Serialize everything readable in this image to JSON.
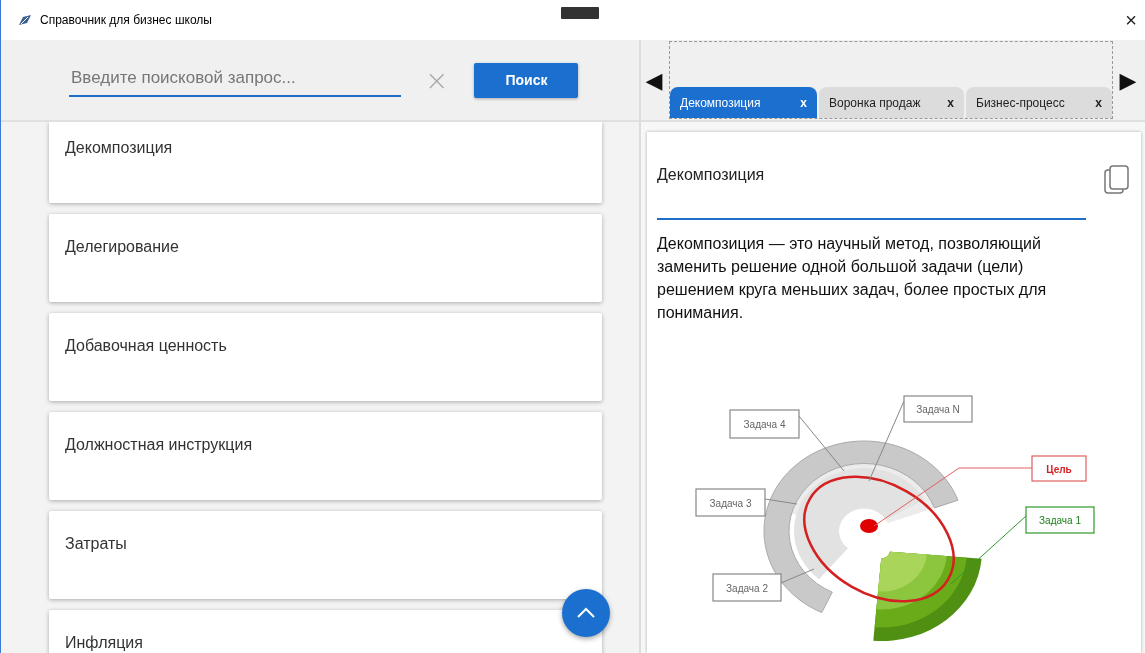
{
  "window": {
    "title": "Справочник для бизнес школы",
    "close": "×"
  },
  "search": {
    "placeholder": "Введите поисковой запрос...",
    "clear": "×",
    "button": "Поиск"
  },
  "terms": [
    "Декомпозиция",
    "Делегирование",
    "Добавочная ценность",
    "Должностная инструкция",
    "Затраты",
    "Инфляция"
  ],
  "tab_nav": {
    "prev": "◀",
    "next": "▶"
  },
  "tabs": [
    {
      "label": "Декомпозиция",
      "close": "x",
      "selected": true
    },
    {
      "label": "Воронка продаж",
      "close": "x",
      "selected": false
    },
    {
      "label": "Бизнес-процесс",
      "close": "x",
      "selected": false
    }
  ],
  "article": {
    "title": "Декомпозиция",
    "text": "Декомпозиция — это научный метод, позволяющий заменить решение одной большой задачи (цели) решением круга меньших задач, более простых для понимания.",
    "diagram_labels": [
      {
        "text": "Задача N",
        "kind": "task"
      },
      {
        "text": "Задача 4",
        "kind": "task"
      },
      {
        "text": "Цель",
        "kind": "goal"
      },
      {
        "text": "Задача 3",
        "kind": "task"
      },
      {
        "text": "Задача 1",
        "kind": "highlight"
      },
      {
        "text": "Задача 2",
        "kind": "task"
      }
    ]
  }
}
